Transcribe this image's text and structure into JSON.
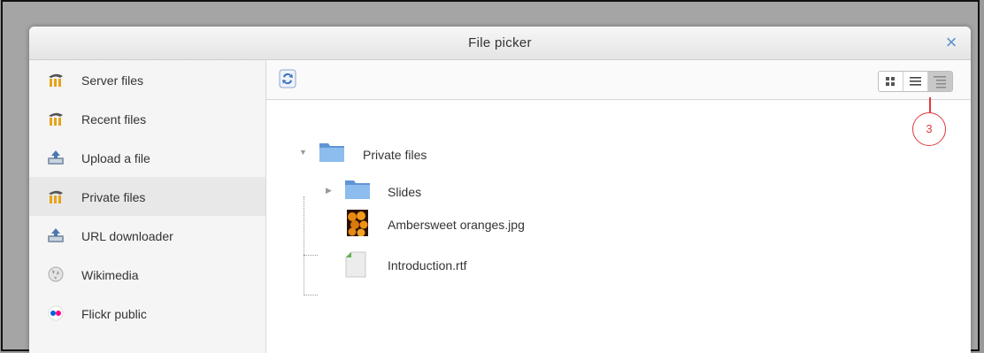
{
  "dialog": {
    "title": "File picker",
    "close_label": "×"
  },
  "sidebar": {
    "items": [
      {
        "label": "Server files",
        "icon": "moodle-icon"
      },
      {
        "label": "Recent files",
        "icon": "moodle-icon"
      },
      {
        "label": "Upload a file",
        "icon": "upload-icon"
      },
      {
        "label": "Private files",
        "icon": "moodle-icon",
        "active": true
      },
      {
        "label": "URL downloader",
        "icon": "url-download-icon"
      },
      {
        "label": "Wikimedia",
        "icon": "wikimedia-icon"
      },
      {
        "label": "Flickr public",
        "icon": "flickr-icon"
      }
    ]
  },
  "toolbar": {
    "view_modes": [
      "icons",
      "list",
      "tree"
    ],
    "active_view": "tree"
  },
  "tree": {
    "root": {
      "label": "Private files",
      "expanded": true
    },
    "children": [
      {
        "label": "Slides",
        "type": "folder",
        "expanded": false
      },
      {
        "label": "Ambersweet oranges.jpg",
        "type": "image"
      },
      {
        "label": "Introduction.rtf",
        "type": "document"
      }
    ]
  },
  "annotation": {
    "label": "3"
  },
  "colors": {
    "accent": "#5b8fd2",
    "callout": "#e0393e",
    "folder": "#7fb1e6",
    "moodle_orange": "#e8a21a"
  }
}
